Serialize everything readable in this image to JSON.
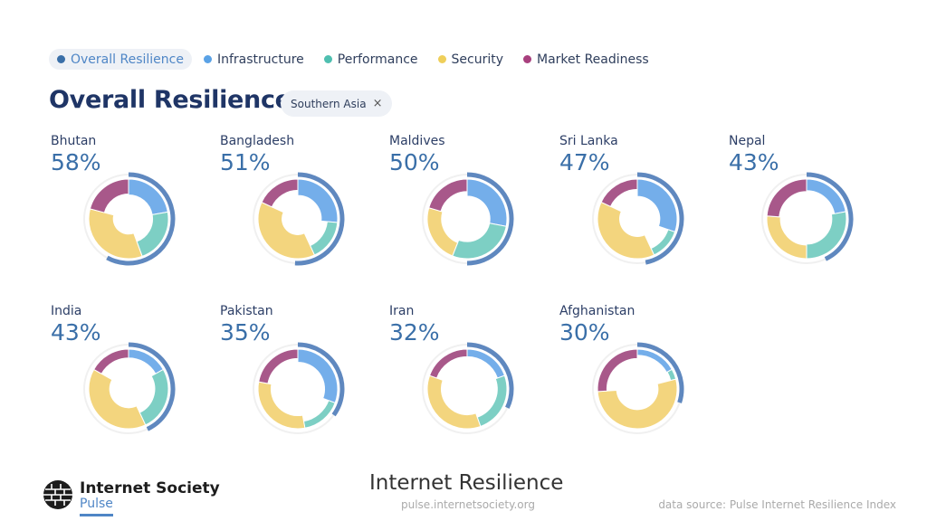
{
  "legend": [
    {
      "label": "Overall Resilience",
      "color": "#3a6fa8",
      "active": true
    },
    {
      "label": "Infrastructure",
      "color": "#5aa2e6",
      "active": false
    },
    {
      "label": "Performance",
      "color": "#4fbfb0",
      "active": false
    },
    {
      "label": "Security",
      "color": "#efcf5a",
      "active": false
    },
    {
      "label": "Market Readiness",
      "color": "#a8407e",
      "active": false
    }
  ],
  "header": {
    "title": "Overall Resilience",
    "filter_chip": "Southern Asia",
    "filter_close": "×"
  },
  "chart_data": {
    "type": "pie",
    "title": "Overall Resilience",
    "subtitle": "Southern Asia",
    "series_names": [
      "Infrastructure",
      "Performance",
      "Security",
      "Market Readiness"
    ],
    "series_colors": [
      "#74aeea",
      "#7dcfc4",
      "#f3d57e",
      "#a8588a"
    ],
    "overall_color": "#5f88bf",
    "countries": [
      {
        "name": "Bhutan",
        "overall_label": "58%",
        "overall": 58,
        "scores": [
          52,
          52,
          81,
          49
        ]
      },
      {
        "name": "Bangladesh",
        "overall_label": "51%",
        "overall": 51,
        "scores": [
          54,
          34,
          79,
          37
        ]
      },
      {
        "name": "Maldives",
        "overall_label": "50%",
        "overall": 50,
        "scores": [
          56,
          56,
          47,
          41
        ]
      },
      {
        "name": "Sri Lanka",
        "overall_label": "47%",
        "overall": 47,
        "scores": [
          57,
          24,
          73,
          34
        ]
      },
      {
        "name": "Nepal",
        "overall_label": "43%",
        "overall": 43,
        "scores": [
          38,
          48,
          45,
          41
        ]
      },
      {
        "name": "India",
        "overall_label": "43%",
        "overall": 43,
        "scores": [
          29,
          45,
          69,
          29
        ]
      },
      {
        "name": "Pakistan",
        "overall_label": "35%",
        "overall": 35,
        "scores": [
          43,
          23,
          43,
          31
        ]
      },
      {
        "name": "Iran",
        "overall_label": "32%",
        "overall": 32,
        "scores": [
          25,
          32,
          46,
          25
        ]
      },
      {
        "name": "Afghanistan",
        "overall_label": "30%",
        "overall": 30,
        "scores": [
          20,
          5,
          63,
          31
        ]
      }
    ]
  },
  "footer": {
    "brand": "Internet Society",
    "brand_sub": "Pulse",
    "title": "Internet Resilience",
    "url": "pulse.internetsociety.org",
    "source": "data source: Pulse Internet Resilience Index"
  }
}
